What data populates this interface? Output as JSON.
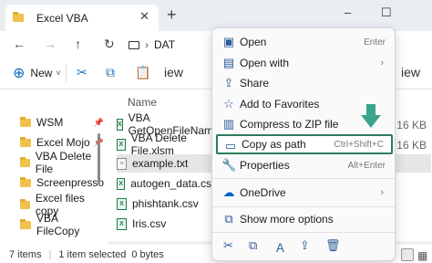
{
  "window": {
    "tab_title": "Excel VBA",
    "close_tab": "✕",
    "new_tab": "+",
    "minimize": "–",
    "maximize": "☐"
  },
  "nav": {
    "back": "←",
    "forward": "→",
    "up": "↑",
    "refresh": "↻",
    "address_text": "DAT"
  },
  "toolbar": {
    "new_label": "New",
    "view_label": "iew"
  },
  "sidebar": {
    "items": [
      {
        "label": "WSM",
        "pinned": true
      },
      {
        "label": "Excel Mojo",
        "pinned": true
      },
      {
        "label": "VBA Delete File",
        "pinned": false
      },
      {
        "label": "Screenpresso",
        "pinned": false
      },
      {
        "label": "Excel files copy",
        "pinned": false
      },
      {
        "label": "VBA FileCopy",
        "pinned": false
      }
    ]
  },
  "files": {
    "column_name": "Name",
    "rows": [
      {
        "name": "VBA GetOpenFileName",
        "size": "16 KB",
        "type": "xl"
      },
      {
        "name": "VBA Delete File.xlsm",
        "size": "16 KB",
        "type": "xl"
      },
      {
        "name": "example.txt",
        "size": "",
        "type": "txt",
        "selected": true
      },
      {
        "name": "autogen_data.csv",
        "size": "",
        "type": "xl"
      },
      {
        "name": "phishtank.csv",
        "size": "",
        "type": "xl"
      },
      {
        "name": "Iris.csv",
        "size": "",
        "type": "xl"
      }
    ]
  },
  "status": {
    "item_count": "7 items",
    "selection": "1 item selected",
    "bytes": "0 bytes"
  },
  "context_menu": {
    "items": [
      {
        "label": "Open",
        "shortcut": "Enter",
        "icon": "open-icon"
      },
      {
        "label": "Open with",
        "arrow": "›",
        "icon": "open-with-icon"
      },
      {
        "label": "Share",
        "icon": "share-icon"
      },
      {
        "label": "Add to Favorites",
        "icon": "star-icon"
      },
      {
        "label": "Compress to ZIP file",
        "icon": "zip-icon"
      },
      {
        "label": "Copy as path",
        "shortcut": "Ctrl+Shift+C",
        "icon": "copy-path-icon",
        "highlighted": true
      },
      {
        "label": "Properties",
        "shortcut": "Alt+Enter",
        "icon": "properties-icon"
      },
      {
        "label": "OneDrive",
        "arrow": "›",
        "icon": "onedrive-icon"
      },
      {
        "label": "Show more options",
        "icon": "more-options-icon"
      }
    ],
    "bottom_icons": [
      "cut-icon",
      "copy-icon",
      "rename-icon",
      "share-icon",
      "delete-icon"
    ]
  },
  "colors": {
    "highlight_border": "#2e7d5b",
    "arrow": "#3aa58a",
    "accent": "#1f6fb8"
  }
}
